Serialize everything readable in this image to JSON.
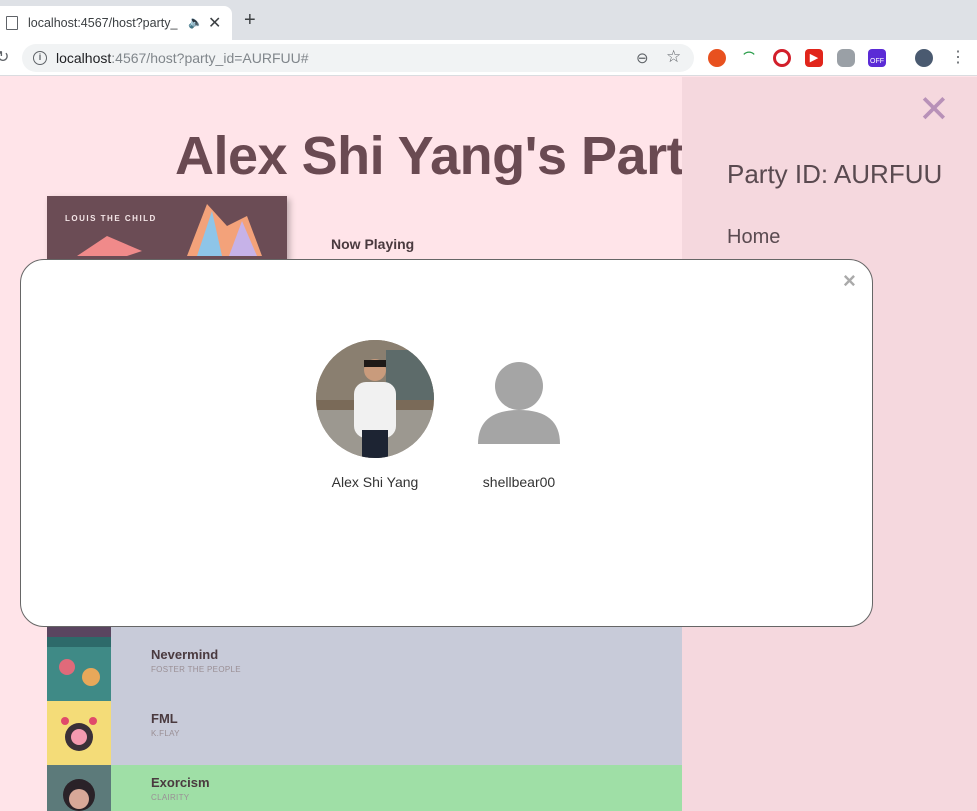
{
  "browser": {
    "tab_title": "localhost:4567/host?party_",
    "url_host": "localhost",
    "url_rest": ":4567/host?party_id=AURFUU#"
  },
  "page": {
    "party_title": "Alex Shi Yang's Part",
    "album_artist": "LOUIS THE CHILD",
    "now_playing_label": "Now Playing",
    "queue": [
      {
        "song": "Nevermind",
        "artist": "FOSTER THE PEOPLE"
      },
      {
        "song": "FML",
        "artist": "K.FLAY"
      },
      {
        "song": "Exorcism",
        "artist": "CLAIRITY"
      }
    ]
  },
  "sidebar": {
    "party_id": "Party ID: AURFUU",
    "home": "Home"
  },
  "modal": {
    "members": [
      {
        "name": "Alex Shi Yang"
      },
      {
        "name": "shellbear00"
      }
    ]
  },
  "colors": {
    "page_bg": "#ffe4e9",
    "sidebar_bg": "#f5d8de",
    "title": "#6a4a52",
    "queue_row": "#c8cbd9",
    "playing_row": "#9fdfa6"
  }
}
